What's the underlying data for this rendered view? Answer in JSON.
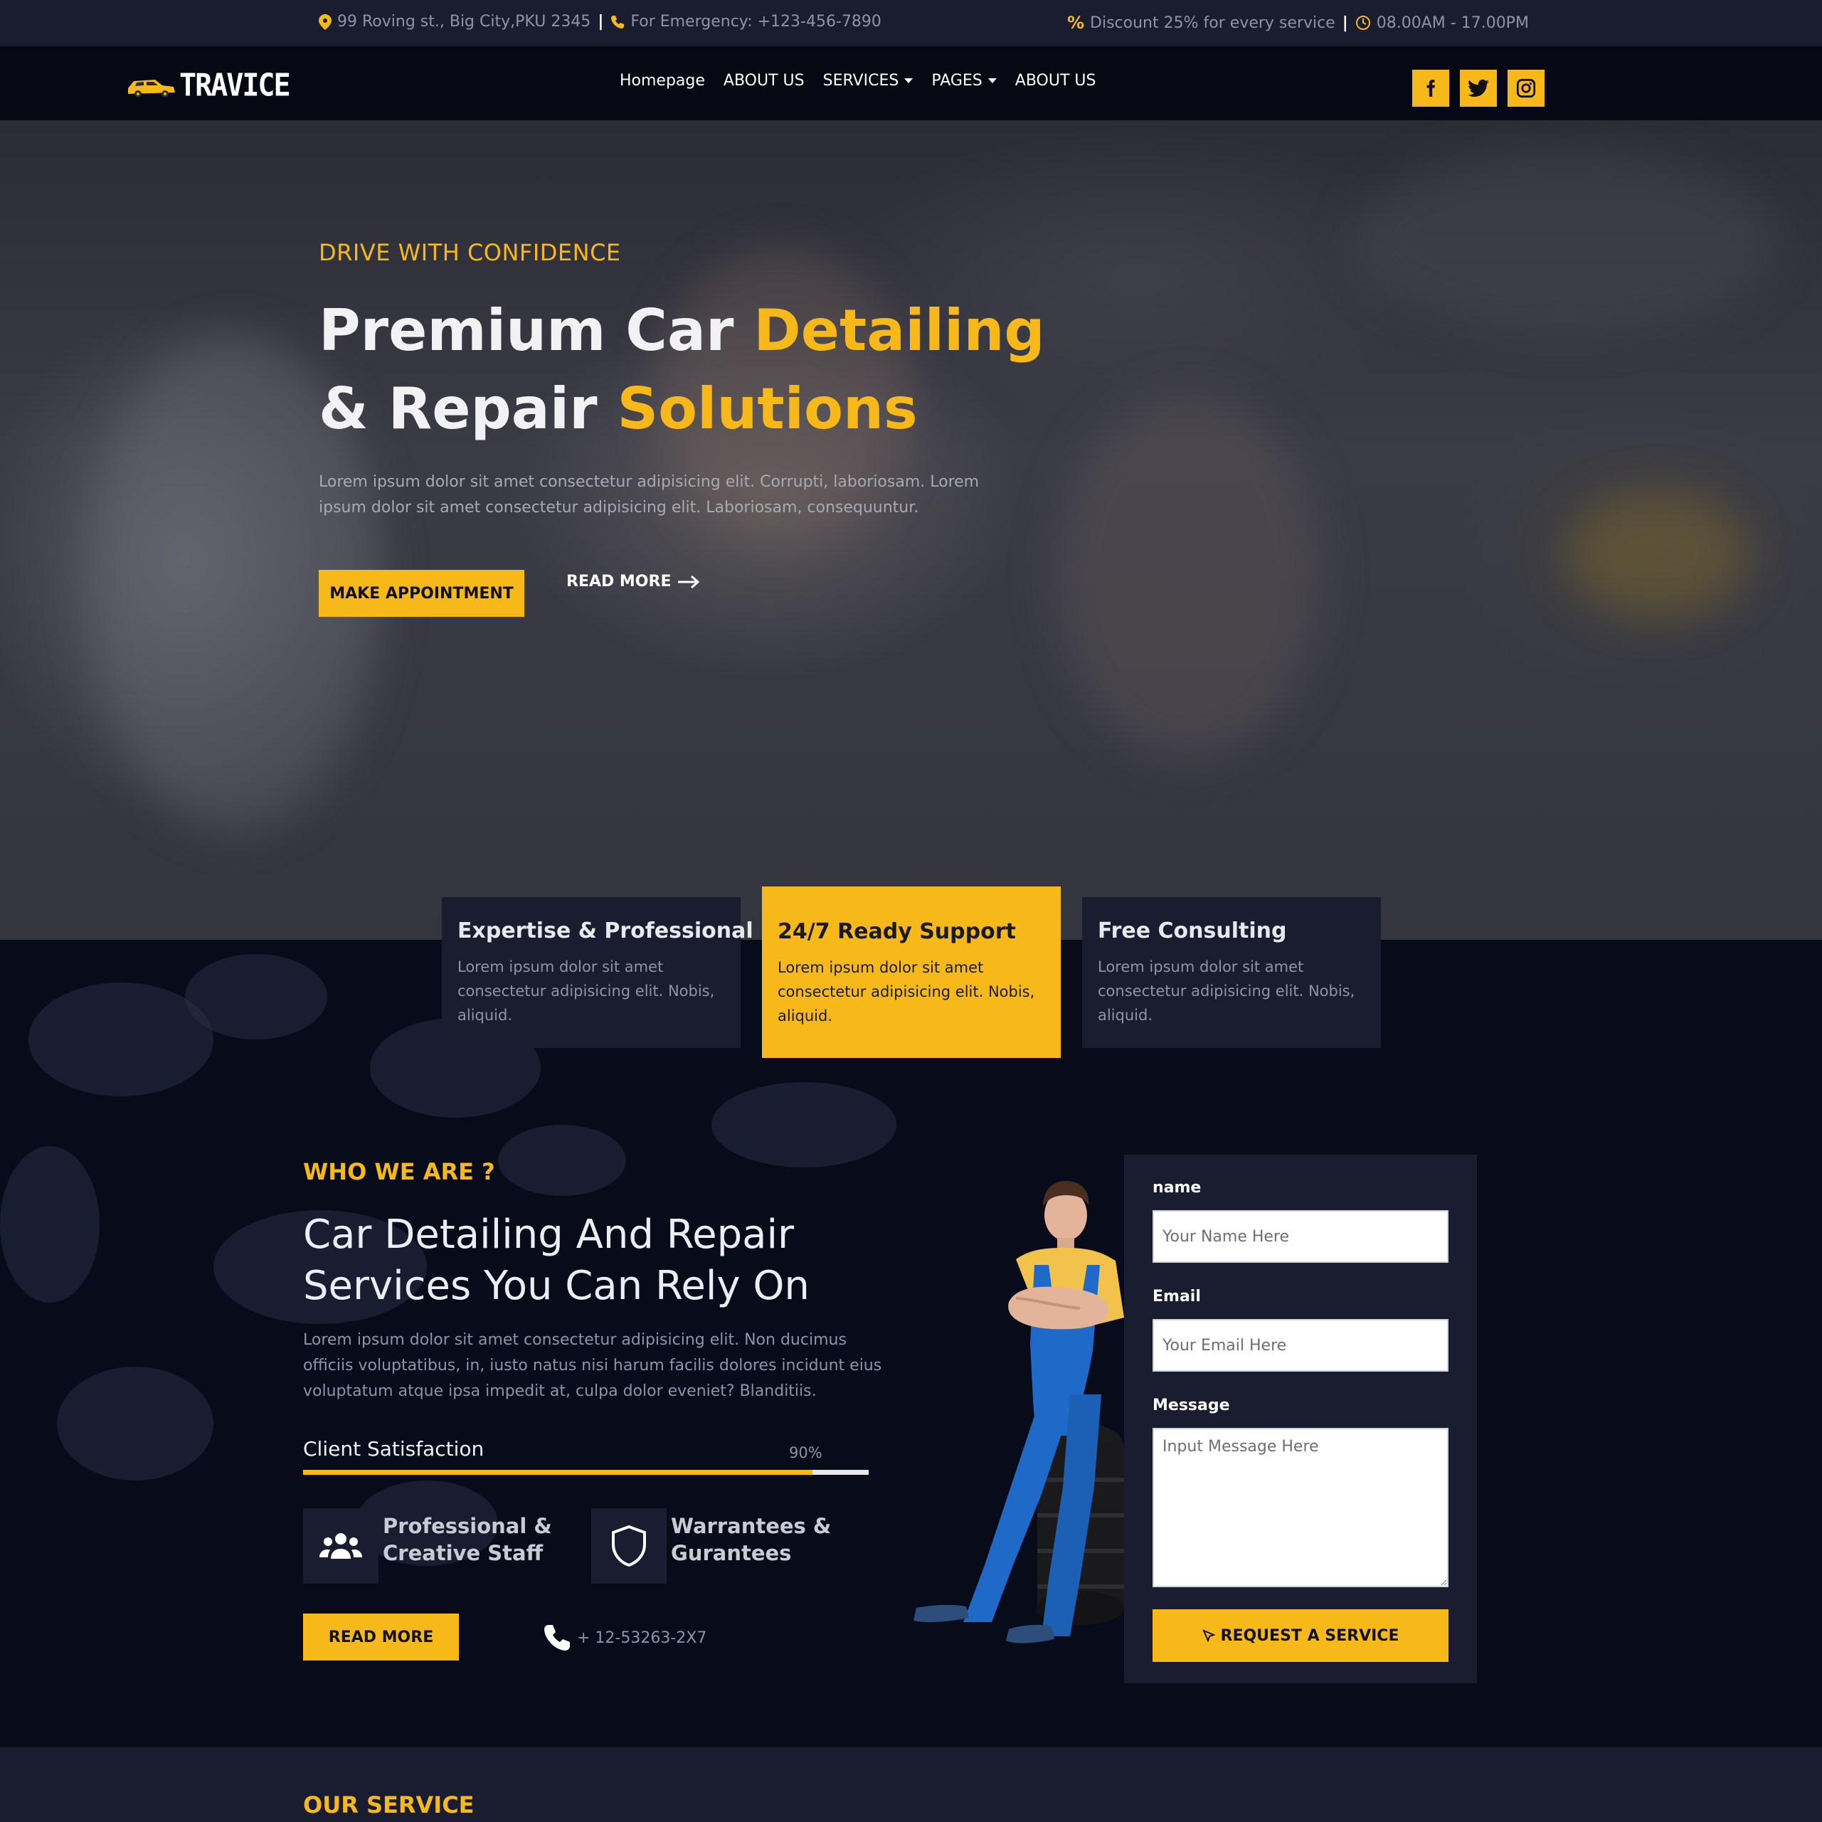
{
  "topbar": {
    "address": "99 Roving st., Big City,PKU 2345",
    "emergency": "For Emergency: +123-456-7890",
    "discount": "Discount 25% for every service",
    "hours": "08.00AM - 17.00PM",
    "separator": "|"
  },
  "nav": {
    "logo": "TRAVICE",
    "links": [
      "Homepage",
      "ABOUT US",
      "SERVICES",
      "PAGES",
      "ABOUT US"
    ],
    "socials": [
      "facebook-icon",
      "twitter-icon",
      "instagram-icon"
    ]
  },
  "hero": {
    "eyebrow": "DRIVE WITH CONFIDENCE",
    "title_line1_a": "Premium Car ",
    "title_line1_b": "Detailing",
    "title_line2_a": "& Repair ",
    "title_line2_b": "Solutions",
    "description": "Lorem ipsum dolor sit amet consectetur adipisicing elit. Corrupti, laboriosam. Lorem ipsum dolor sit amet consectetur adipisicing elit. Laboriosam, consequuntur.",
    "primary_button": "MAKE APPOINTMENT",
    "secondary_button": "READ MORE"
  },
  "features": [
    {
      "title": "Expertise & Professional",
      "text": "Lorem ipsum dolor sit amet consectetur adipisicing elit. Nobis, aliquid."
    },
    {
      "title": "24/7 Ready Support",
      "text": "Lorem ipsum dolor sit amet consectetur adipisicing elit. Nobis, aliquid."
    },
    {
      "title": "Free Consulting",
      "text": "Lorem ipsum dolor sit amet consectetur adipisicing elit. Nobis, aliquid."
    }
  ],
  "about": {
    "eyebrow": "WHO WE ARE ?",
    "title": "Car Detailing And Repair Services You Can Rely On",
    "description": "Lorem ipsum dolor sit amet consectetur adipisicing elit. Non ducimus officiis voluptatibus, in, iusto natus nisi harum facilis dolores incidunt eius voluptatum atque ipsa impedit at, culpa dolor eveniet? Blanditiis.",
    "satisfaction_label": "Client Satisfaction",
    "satisfaction_value": "90%",
    "satisfaction_fraction": 0.9,
    "feature1_line1": "Professional &",
    "feature1_line2": "Creative Staff",
    "feature2_line1": "Warrantees &",
    "feature2_line2": "Gurantees",
    "button": "READ MORE",
    "phone": "+ 12-53263-2X7"
  },
  "form": {
    "name_label": "name",
    "name_placeholder": "Your Name Here",
    "email_label": "Email",
    "email_placeholder": "Your Email Here",
    "message_label": "Message",
    "message_placeholder": "Input Message Here",
    "submit": "REQUEST A SERVICE"
  },
  "service": {
    "eyebrow": "OUR SERVICE"
  },
  "colors": {
    "accent": "#f7b91a",
    "dark": "#070b1a",
    "panel": "#1a1d2f"
  }
}
